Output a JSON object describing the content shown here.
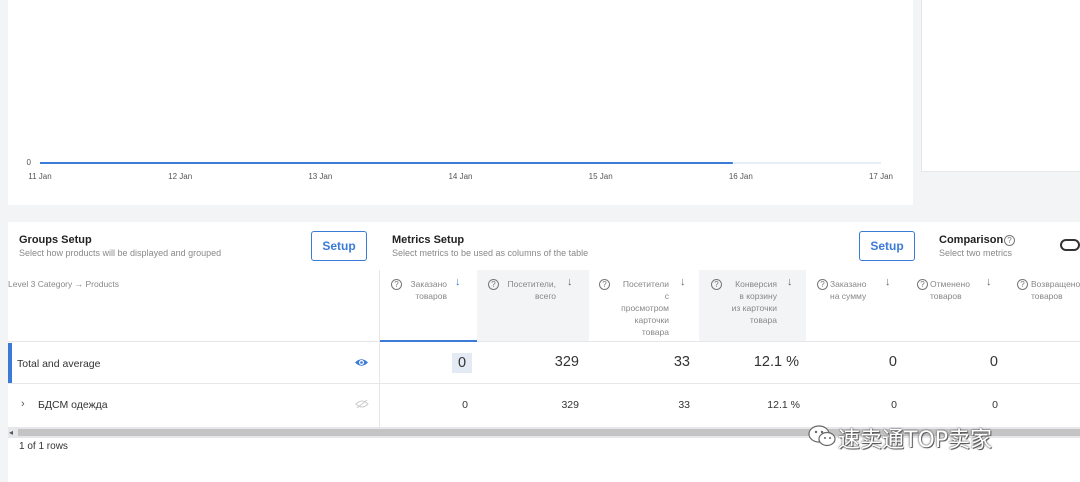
{
  "chart": {
    "y_tick": "0",
    "x_ticks": [
      "11 Jan",
      "12 Jan",
      "13 Jan",
      "14 Jan",
      "15 Jan",
      "16 Jan",
      "17 Jan"
    ],
    "line_color": "#3b7bd8",
    "series_value": 0
  },
  "groups_setup": {
    "title": "Groups Setup",
    "subtitle": "Select how products will be displayed and grouped",
    "button": "Setup"
  },
  "metrics_setup": {
    "title": "Metrics Setup",
    "subtitle": "Select metrics to be used as columns of the table",
    "button": "Setup"
  },
  "comparison": {
    "title": "Comparison",
    "subtitle": "Select two metrics"
  },
  "table": {
    "grouping_label": "Level 3 Category → Products",
    "columns": [
      {
        "label": "Заказано\nтоваров"
      },
      {
        "label": "Посетители,\nвсего"
      },
      {
        "label": "Посетители\nс\nпросмотром\nкарточки\nтовара"
      },
      {
        "label": "Конверсия\nв корзину\nиз карточки\nтовара"
      },
      {
        "label": "Заказано\nна сумму"
      },
      {
        "label": "Отменено\nтоваров"
      },
      {
        "label": "Возвращено\nтоваров"
      }
    ],
    "total_row": {
      "label": "Total and average",
      "values": [
        "0",
        "329",
        "33",
        "12.1 %",
        "0",
        "0"
      ]
    },
    "rows": [
      {
        "label": "БДСМ одежда",
        "values": [
          "0",
          "329",
          "33",
          "12.1 %",
          "0",
          "0"
        ]
      }
    ],
    "footer": "1 of 1 rows"
  },
  "watermark": "速卖通TOP卖家",
  "accent_color": "#3b7bd8"
}
